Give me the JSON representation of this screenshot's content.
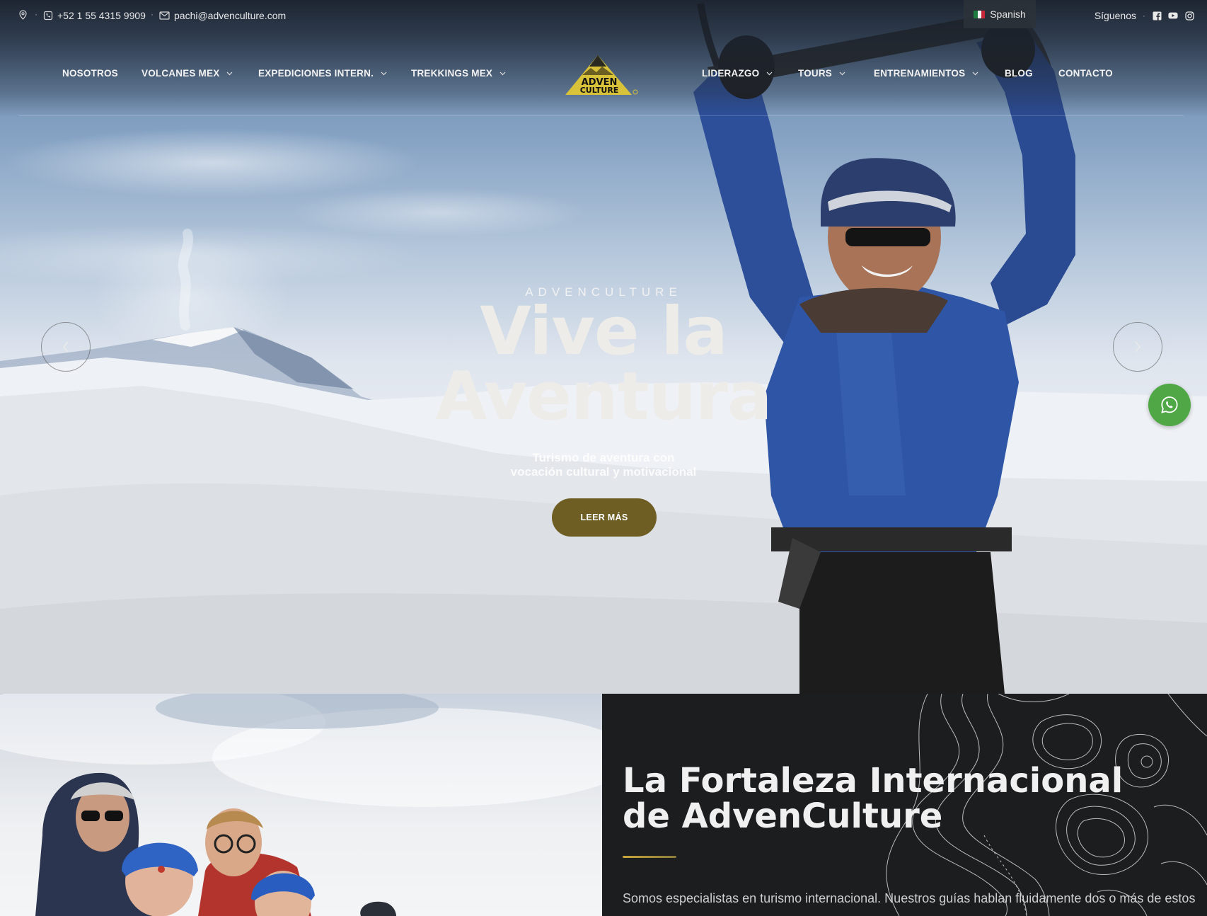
{
  "topbar": {
    "phone": "+52 1 55 4315 9909",
    "email": "pachi@advenculture.com",
    "language": "Spanish",
    "follow_label": "Síguenos",
    "icons": [
      "location-icon",
      "phone-icon",
      "mail-icon",
      "facebook-icon",
      "youtube-icon",
      "instagram-icon"
    ]
  },
  "nav": {
    "left": [
      {
        "label": "NOSOTROS",
        "dropdown": false
      },
      {
        "label": "VOLCANES MEX",
        "dropdown": true
      },
      {
        "label": "EXPEDICIONES INTERN.",
        "dropdown": true
      },
      {
        "label": "TREKKINGS MEX",
        "dropdown": true
      }
    ],
    "right": [
      {
        "label": "LIDERAZGO",
        "dropdown": true
      },
      {
        "label": "TOURS",
        "dropdown": true
      },
      {
        "label": "ENTRENAMIENTOS",
        "dropdown": true
      },
      {
        "label": "BLOG",
        "dropdown": false
      },
      {
        "label": "CONTACTO",
        "dropdown": false
      }
    ],
    "logo_text": [
      "ADVEN",
      "CULTURE"
    ]
  },
  "hero": {
    "eyebrow": "ADVENCULTURE",
    "headline_line1": "Vive la",
    "headline_line2": "Aventura",
    "subtitle_line1": "Turismo de aventura con",
    "subtitle_line2": "vocación cultural y motivacional",
    "cta": "LEER MÁS",
    "cta_color": "#6e5e23"
  },
  "about": {
    "title": "La Fortaleza Internacional de AdvenCulture",
    "text": "Somos especialistas en turismo internacional. Nuestros guías hablan fluidamente dos o más de estos",
    "accent_color": "#c9a63a"
  },
  "whatsapp_color": "#4fa845"
}
